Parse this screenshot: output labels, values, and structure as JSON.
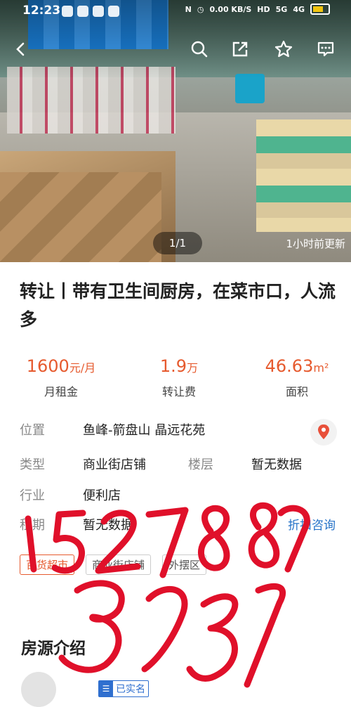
{
  "status_bar": {
    "time": "12:23",
    "speed": "0.00 KB/S",
    "network_1": "5G",
    "network_2": "4G"
  },
  "toolbar": {
    "icons": [
      "back-icon",
      "search-icon",
      "share-icon",
      "star-icon",
      "message-icon"
    ]
  },
  "gallery": {
    "counter": "1/1",
    "updated": "1小时前更新"
  },
  "listing": {
    "title": "转让丨带有卫生间厨房，在菜市口，人流多",
    "rent_value": "1600",
    "rent_unit": "元/月",
    "rent_label": "月租金",
    "fee_value": "1.9",
    "fee_unit": "万",
    "fee_label": "转让费",
    "area_value": "46.63",
    "area_unit": "m²",
    "area_label": "面积"
  },
  "info": {
    "location_label": "位置",
    "location_value": "鱼峰-箭盘山 晶远花苑",
    "type_label": "类型",
    "type_value": "商业街店铺",
    "floor_label": "楼层",
    "floor_value": "暂无数据",
    "industry_label": "行业",
    "industry_value": "便利店",
    "term_label": "租期",
    "term_value": "暂无数据",
    "consult_label": "折扣咨询"
  },
  "tags": [
    "百货超市",
    "商业街店铺",
    "外摆区"
  ],
  "section": {
    "title": "房源介绍",
    "verified_badge": "已实名"
  },
  "overlay": {
    "handwritten_number": "152788 3937",
    "ink_color": "#e0102a"
  },
  "colors": {
    "accent_orange": "#e65a2e",
    "link_blue": "#2472c8"
  }
}
